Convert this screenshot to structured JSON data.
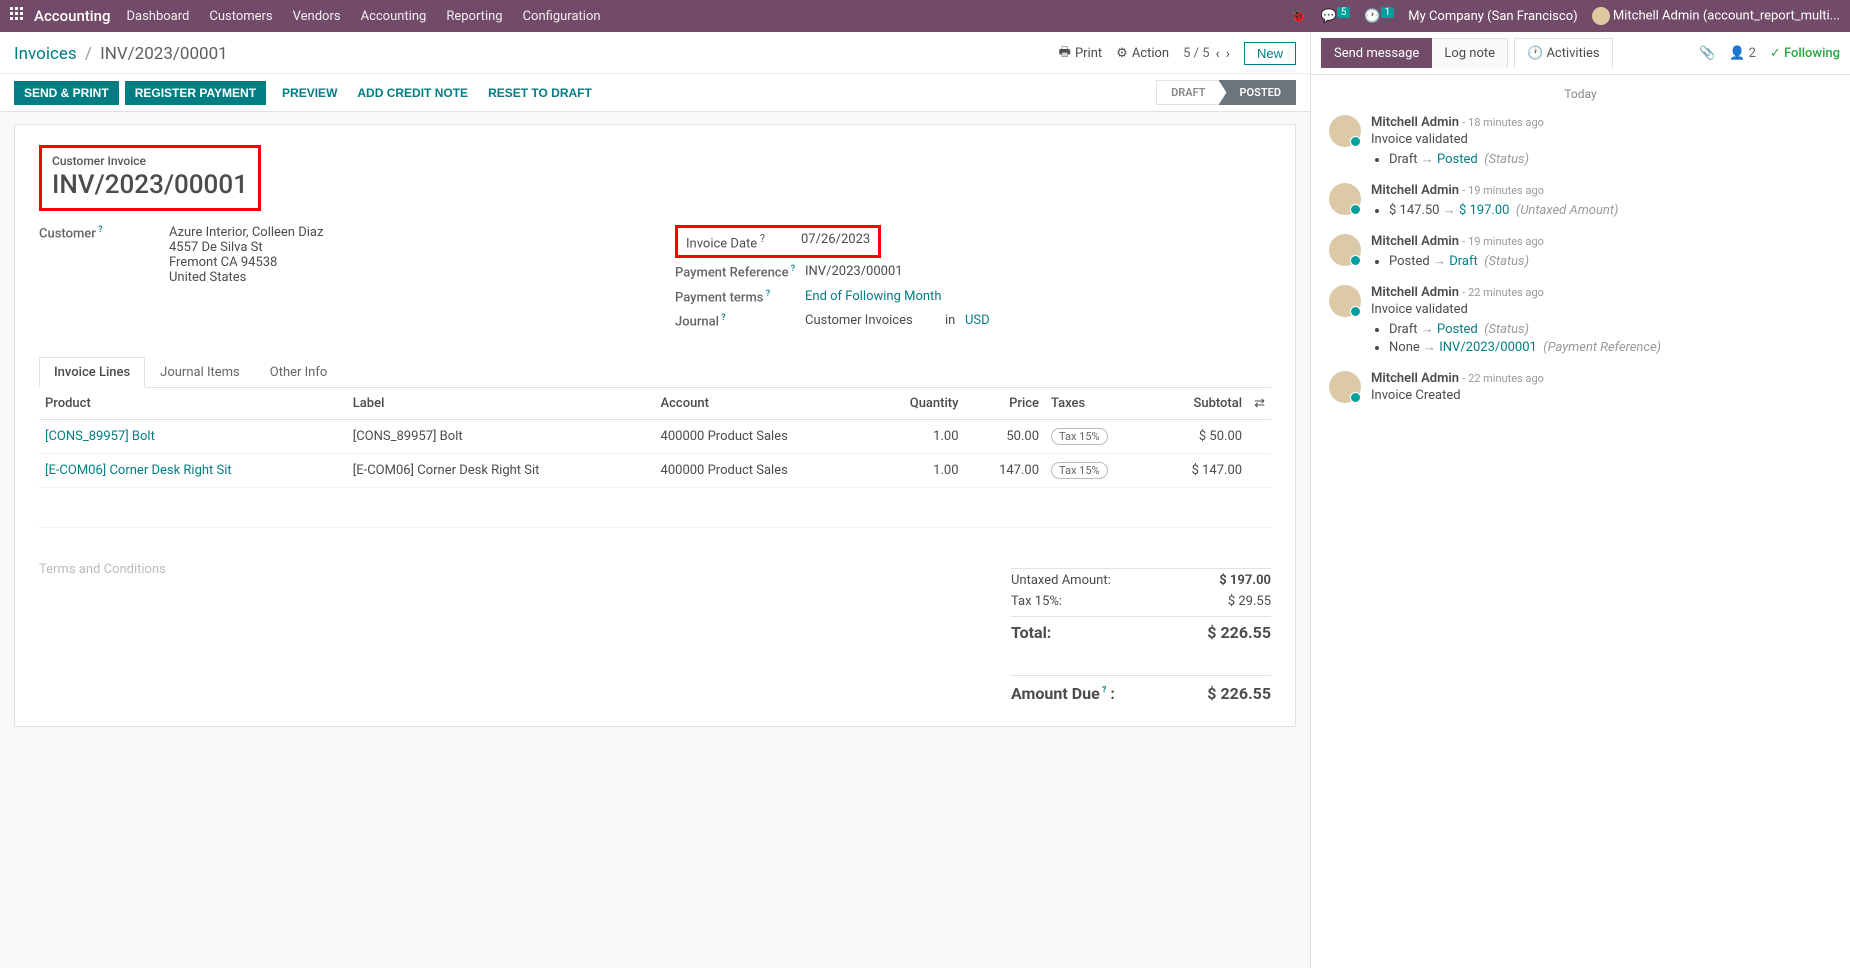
{
  "topnav": {
    "brand": "Accounting",
    "menu": [
      "Dashboard",
      "Customers",
      "Vendors",
      "Accounting",
      "Reporting",
      "Configuration"
    ],
    "msg_badge": "5",
    "act_badge": "1",
    "company": "My Company (San Francisco)",
    "user": "Mitchell Admin (account_report_multi..."
  },
  "breadcrumb": {
    "root": "Invoices",
    "current": "INV/2023/00001"
  },
  "controls": {
    "print": "Print",
    "action": "Action",
    "pager": "5 / 5",
    "new": "New"
  },
  "actions": {
    "send_print": "SEND & PRINT",
    "register_payment": "REGISTER PAYMENT",
    "preview": "PREVIEW",
    "add_credit_note": "ADD CREDIT NOTE",
    "reset_draft": "RESET TO DRAFT",
    "status_draft": "DRAFT",
    "status_posted": "POSTED"
  },
  "invoice": {
    "title_label": "Customer Invoice",
    "title": "INV/2023/00001",
    "customer_label": "Customer",
    "customer_name": "Azure Interior, Colleen Diaz",
    "addr1": "4557 De Silva St",
    "addr2": "Fremont CA 94538",
    "addr3": "United States",
    "date_label": "Invoice Date",
    "date": "07/26/2023",
    "ref_label": "Payment Reference",
    "ref": "INV/2023/00001",
    "terms_label": "Payment terms",
    "terms": "End of Following Month",
    "journal_label": "Journal",
    "journal": "Customer Invoices",
    "in": "in",
    "currency": "USD"
  },
  "tabs": [
    "Invoice Lines",
    "Journal Items",
    "Other Info"
  ],
  "columns": {
    "product": "Product",
    "label": "Label",
    "account": "Account",
    "qty": "Quantity",
    "price": "Price",
    "taxes": "Taxes",
    "subtotal": "Subtotal"
  },
  "lines": [
    {
      "product": "[CONS_89957] Bolt",
      "label": "[CONS_89957] Bolt",
      "account": "400000 Product Sales",
      "qty": "1.00",
      "price": "50.00",
      "tax": "Tax 15%",
      "subtotal": "$ 50.00"
    },
    {
      "product": "[E-COM06] Corner Desk Right Sit",
      "label": "[E-COM06] Corner Desk Right Sit",
      "account": "400000 Product Sales",
      "qty": "1.00",
      "price": "147.00",
      "tax": "Tax 15%",
      "subtotal": "$ 147.00"
    }
  ],
  "terms_placeholder": "Terms and Conditions",
  "totals": {
    "untaxed_label": "Untaxed Amount:",
    "untaxed": "$ 197.00",
    "tax_label": "Tax 15%:",
    "tax": "$ 29.55",
    "total_label": "Total:",
    "total": "$ 226.55",
    "due_label": "Amount Due",
    "due": "$ 226.55"
  },
  "rp": {
    "send": "Send message",
    "lognote": "Log note",
    "activities": "Activities",
    "followers": "2",
    "following": "Following",
    "today": "Today"
  },
  "messages": [
    {
      "name": "Mitchell Admin",
      "time": "- 18 minutes ago",
      "text": "Invoice validated",
      "bullets": [
        {
          "from": "Draft",
          "to": "Posted",
          "note": "(Status)"
        }
      ]
    },
    {
      "name": "Mitchell Admin",
      "time": "- 19 minutes ago",
      "bullets": [
        {
          "from": "$ 147.50",
          "to": "$ 197.00",
          "note": "(Untaxed Amount)"
        }
      ]
    },
    {
      "name": "Mitchell Admin",
      "time": "- 19 minutes ago",
      "bullets": [
        {
          "from": "Posted",
          "to": "Draft",
          "note": "(Status)"
        }
      ]
    },
    {
      "name": "Mitchell Admin",
      "time": "- 22 minutes ago",
      "text": "Invoice validated",
      "bullets": [
        {
          "from": "Draft",
          "to": "Posted",
          "note": "(Status)"
        },
        {
          "from": "None",
          "to": "INV/2023/00001",
          "note": "(Payment Reference)"
        }
      ]
    },
    {
      "name": "Mitchell Admin",
      "time": "- 22 minutes ago",
      "text": "Invoice Created"
    }
  ]
}
